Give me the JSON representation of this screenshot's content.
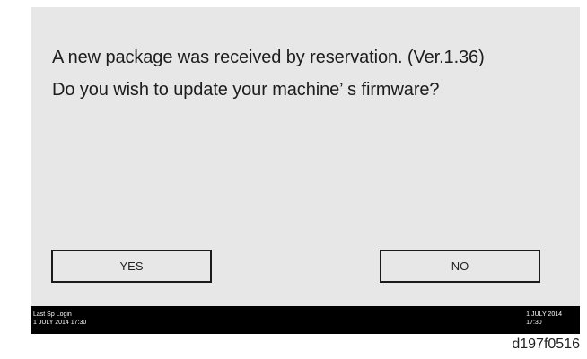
{
  "dialog": {
    "message_line1": "A new package was received by reservation. (Ver.1.36)",
    "message_line2": "Do you wish to update your machine’ s firmware?"
  },
  "buttons": {
    "yes_label": "YES",
    "no_label": "NO"
  },
  "status_bar": {
    "left_title": "Last Sp Login",
    "left_datetime": "1 JULY 2014 17:30",
    "right_date": "1 JULY 2014",
    "right_time": "17:30"
  },
  "figure_id": "d197f0516",
  "colors": {
    "screen_background": "#e7e7e7",
    "status_bar_background": "#000000",
    "status_bar_text": "#ffffff"
  }
}
